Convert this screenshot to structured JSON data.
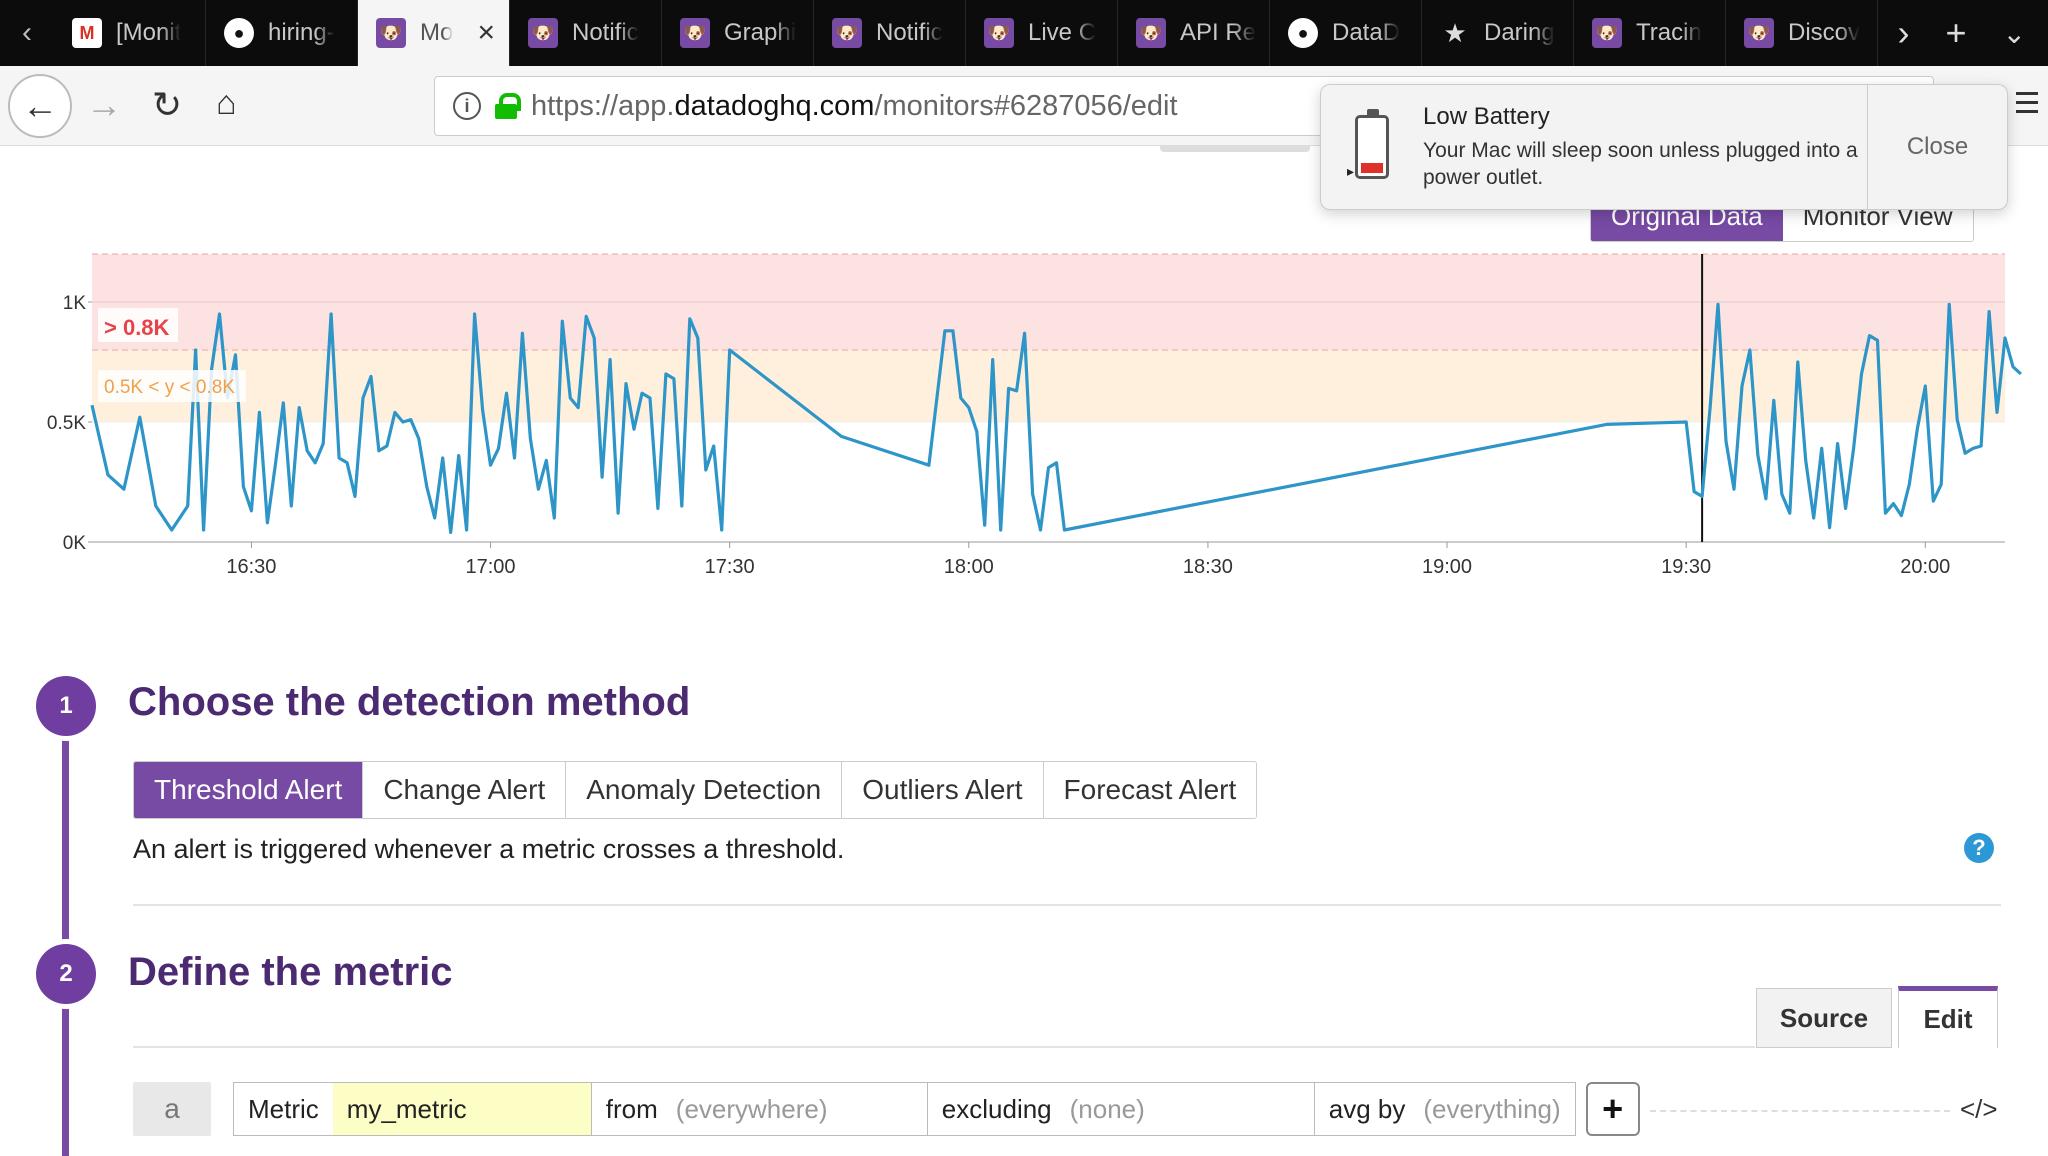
{
  "tabs": [
    {
      "label": "[Monit",
      "icon": "gmail-icon",
      "glyph": "M"
    },
    {
      "label": "hiring-",
      "icon": "github-icon",
      "glyph": "●"
    },
    {
      "label": "Mo",
      "icon": "datadog-icon",
      "glyph": "🐶",
      "active": true
    },
    {
      "label": "Notific",
      "icon": "datadog-icon",
      "glyph": "🐶"
    },
    {
      "label": "Graphi",
      "icon": "datadog-icon",
      "glyph": "🐶"
    },
    {
      "label": "Notific",
      "icon": "datadog-icon",
      "glyph": "🐶"
    },
    {
      "label": "Live C",
      "icon": "datadog-icon",
      "glyph": "🐶"
    },
    {
      "label": "API Re",
      "icon": "datadog-icon",
      "glyph": "🐶"
    },
    {
      "label": "DataD",
      "icon": "github-icon",
      "glyph": "●"
    },
    {
      "label": "Daring",
      "icon": "star-icon",
      "glyph": "★"
    },
    {
      "label": "Tracin",
      "icon": "datadog-icon",
      "glyph": "🐶"
    },
    {
      "label": "Discov",
      "icon": "datadog-icon",
      "glyph": "🐶"
    }
  ],
  "browser": {
    "url_prefix": "https://app.",
    "url_domain": "datadoghq.com",
    "url_suffix": "/monitors#6287056/edit"
  },
  "notification": {
    "title": "Low Battery",
    "body": "Your Mac will sleep soon unless plugged into a power outlet.",
    "close_label": "Close"
  },
  "view_toggle": {
    "original": "Original Data",
    "monitor": "Monitor View"
  },
  "chart_data": {
    "type": "line",
    "y_ticks": [
      "0K",
      "0.5K",
      "1K"
    ],
    "ylim": [
      0,
      1200
    ],
    "x_ticks": [
      "16:30",
      "17:00",
      "17:30",
      "18:00",
      "18:30",
      "19:00",
      "19:30",
      "20:00"
    ],
    "xlim_minutes_after_1620": [
      -10,
      230
    ],
    "thresholds": {
      "critical": {
        "value": 800,
        "label": "> 0.8K",
        "color": "#e7434a",
        "band_color": "#fde2e2"
      },
      "warning": {
        "value": 500,
        "range_label": "0.5K < y < 0.8K",
        "color": "#f0a04b",
        "band_color": "#fff0dd"
      }
    },
    "marker_x": "19:32",
    "series": [
      {
        "color": "#2e95c8",
        "points": [
          [
            -10,
            570
          ],
          [
            -8,
            280
          ],
          [
            -6,
            220
          ],
          [
            -4,
            520
          ],
          [
            -2,
            150
          ],
          [
            0,
            50
          ],
          [
            2,
            150
          ],
          [
            3,
            800
          ],
          [
            4,
            50
          ],
          [
            5,
            720
          ],
          [
            6,
            950
          ],
          [
            7,
            600
          ],
          [
            8,
            780
          ],
          [
            9,
            230
          ],
          [
            10,
            130
          ],
          [
            11,
            540
          ],
          [
            12,
            80
          ],
          [
            13,
            320
          ],
          [
            14,
            580
          ],
          [
            15,
            150
          ],
          [
            16,
            560
          ],
          [
            17,
            380
          ],
          [
            18,
            330
          ],
          [
            19,
            410
          ],
          [
            20,
            950
          ],
          [
            21,
            350
          ],
          [
            22,
            330
          ],
          [
            23,
            190
          ],
          [
            24,
            600
          ],
          [
            25,
            690
          ],
          [
            26,
            380
          ],
          [
            27,
            400
          ],
          [
            28,
            540
          ],
          [
            29,
            500
          ],
          [
            30,
            510
          ],
          [
            31,
            430
          ],
          [
            32,
            230
          ],
          [
            33,
            100
          ],
          [
            34,
            350
          ],
          [
            35,
            40
          ],
          [
            36,
            360
          ],
          [
            37,
            50
          ],
          [
            38,
            950
          ],
          [
            39,
            550
          ],
          [
            40,
            320
          ],
          [
            41,
            390
          ],
          [
            42,
            620
          ],
          [
            43,
            350
          ],
          [
            44,
            870
          ],
          [
            45,
            430
          ],
          [
            46,
            220
          ],
          [
            47,
            340
          ],
          [
            48,
            100
          ],
          [
            49,
            920
          ],
          [
            50,
            600
          ],
          [
            51,
            560
          ],
          [
            52,
            940
          ],
          [
            53,
            850
          ],
          [
            54,
            270
          ],
          [
            55,
            760
          ],
          [
            56,
            120
          ],
          [
            57,
            660
          ],
          [
            58,
            470
          ],
          [
            59,
            620
          ],
          [
            60,
            600
          ],
          [
            61,
            140
          ],
          [
            62,
            700
          ],
          [
            63,
            680
          ],
          [
            64,
            150
          ],
          [
            65,
            930
          ],
          [
            66,
            850
          ],
          [
            67,
            300
          ],
          [
            68,
            400
          ],
          [
            69,
            50
          ],
          [
            70,
            800
          ],
          [
            84,
            440
          ],
          [
            95,
            320
          ],
          [
            97,
            880
          ],
          [
            98,
            880
          ],
          [
            99,
            600
          ],
          [
            100,
            560
          ],
          [
            101,
            460
          ],
          [
            102,
            70
          ],
          [
            103,
            760
          ],
          [
            104,
            50
          ],
          [
            105,
            640
          ],
          [
            106,
            630
          ],
          [
            107,
            870
          ],
          [
            108,
            200
          ],
          [
            109,
            50
          ],
          [
            110,
            310
          ],
          [
            111,
            330
          ],
          [
            112,
            50
          ],
          [
            180,
            490
          ],
          [
            190,
            500
          ],
          [
            191,
            210
          ],
          [
            192,
            190
          ],
          [
            193,
            560
          ],
          [
            194,
            990
          ],
          [
            195,
            420
          ],
          [
            196,
            220
          ],
          [
            197,
            650
          ],
          [
            198,
            800
          ],
          [
            199,
            360
          ],
          [
            200,
            180
          ],
          [
            201,
            590
          ],
          [
            202,
            200
          ],
          [
            203,
            120
          ],
          [
            204,
            750
          ],
          [
            205,
            340
          ],
          [
            206,
            100
          ],
          [
            207,
            390
          ],
          [
            208,
            60
          ],
          [
            209,
            410
          ],
          [
            210,
            140
          ],
          [
            211,
            390
          ],
          [
            212,
            700
          ],
          [
            213,
            860
          ],
          [
            214,
            840
          ],
          [
            215,
            120
          ],
          [
            216,
            160
          ],
          [
            217,
            110
          ],
          [
            218,
            240
          ],
          [
            219,
            470
          ],
          [
            220,
            650
          ],
          [
            221,
            170
          ],
          [
            222,
            240
          ],
          [
            223,
            990
          ],
          [
            224,
            510
          ],
          [
            225,
            370
          ],
          [
            226,
            390
          ],
          [
            227,
            400
          ],
          [
            228,
            960
          ],
          [
            229,
            540
          ],
          [
            230,
            850
          ],
          [
            231,
            730
          ],
          [
            232,
            700
          ]
        ]
      }
    ]
  },
  "section1": {
    "step": "1",
    "title": "Choose the detection method",
    "tabs": [
      "Threshold Alert",
      "Change Alert",
      "Anomaly Detection",
      "Outliers Alert",
      "Forecast Alert"
    ],
    "description": "An alert is triggered whenever a metric crosses a threshold.",
    "help": "?"
  },
  "section2": {
    "step": "2",
    "title": "Define the metric",
    "source_label": "Source",
    "edit_label": "Edit",
    "query": {
      "letter": "a",
      "metric_label": "Metric",
      "metric_value": "my_metric",
      "from_label": "from",
      "from_value": "(everywhere)",
      "excluding_label": "excluding",
      "excluding_value": "(none)",
      "avg_label": "avg by",
      "avg_value": "(everything)",
      "plus": "+",
      "code": "</>"
    }
  }
}
